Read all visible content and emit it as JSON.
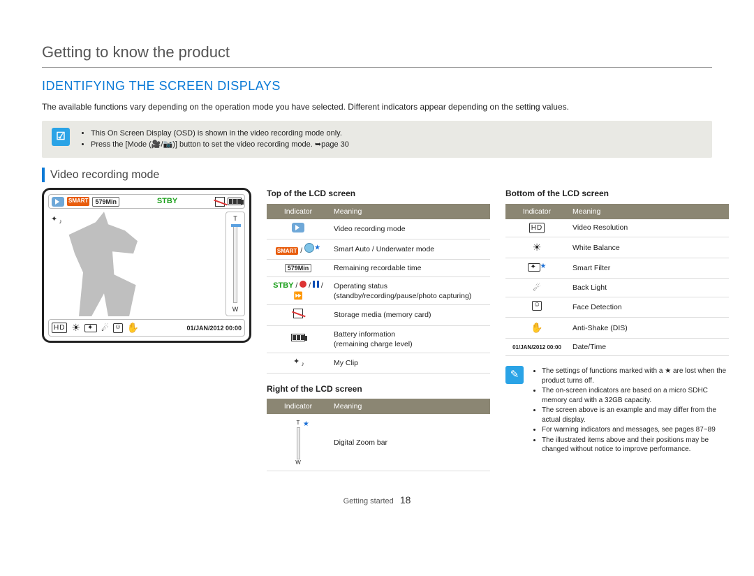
{
  "chapter_title": "Getting to know the product",
  "section_title": "IDENTIFYING THE SCREEN DISPLAYS",
  "intro_text": "The available functions vary depending on the operation mode you have selected. Different indicators appear depending on the setting values.",
  "note_box": {
    "items": [
      "This On Screen Display (OSD) is shown in the video recording mode only.",
      "Press the [Mode (🎥/📷)] button to set the video recording mode. ➥page 30"
    ]
  },
  "subsection_title": "Video recording mode",
  "lcd": {
    "smart_label": "SMART",
    "remain": "579Min",
    "stby": "STBY",
    "zoom_t": "T",
    "zoom_w": "W",
    "hd": "HD",
    "datetime": "01/JAN/2012 00:00"
  },
  "tables": {
    "top": {
      "title": "Top of the LCD screen",
      "header_indicator": "Indicator",
      "header_meaning": "Meaning",
      "rows": [
        {
          "icon": "video",
          "meaning": "Video recording mode"
        },
        {
          "icon": "smart-uw",
          "star": true,
          "meaning": "Smart Auto / Underwater mode"
        },
        {
          "icon": "579min",
          "meaning": "Remaining recordable time"
        },
        {
          "icon": "status",
          "meaning": "Operating status (standby/recording/pause/photo capturing)"
        },
        {
          "icon": "card",
          "meaning": "Storage media (memory card)"
        },
        {
          "icon": "battery",
          "meaning": "Battery information\n(remaining charge level)"
        },
        {
          "icon": "myclip",
          "meaning": "My Clip"
        }
      ]
    },
    "right": {
      "title": "Right of the LCD screen",
      "header_indicator": "Indicator",
      "header_meaning": "Meaning",
      "rows": [
        {
          "icon": "zoom",
          "star": true,
          "meaning": "Digital Zoom bar"
        }
      ]
    },
    "bottom": {
      "title": "Bottom of the LCD screen",
      "header_indicator": "Indicator",
      "header_meaning": "Meaning",
      "rows": [
        {
          "icon": "hd",
          "meaning": "Video Resolution"
        },
        {
          "icon": "wb",
          "meaning": "White Balance"
        },
        {
          "icon": "sf",
          "star": true,
          "meaning": "Smart Filter"
        },
        {
          "icon": "bl",
          "meaning": "Back Light"
        },
        {
          "icon": "fd",
          "meaning": "Face Detection"
        },
        {
          "icon": "as",
          "meaning": "Anti-Shake (DIS)"
        },
        {
          "icon": "dt",
          "text": "01/JAN/2012 00:00",
          "meaning": "Date/Time"
        }
      ]
    }
  },
  "side_note": {
    "items": [
      "The settings of functions marked with a ★ are lost when the product turns off.",
      "The on-screen indicators are based on a micro SDHC memory card with a 32GB capacity.",
      "The screen above is an example and may differ from the actual display.",
      "For warning indicators and messages, see pages 87~89",
      "The illustrated items above and their positions may be changed without notice to improve performance."
    ]
  },
  "footer": {
    "label": "Getting started",
    "page": "18"
  }
}
